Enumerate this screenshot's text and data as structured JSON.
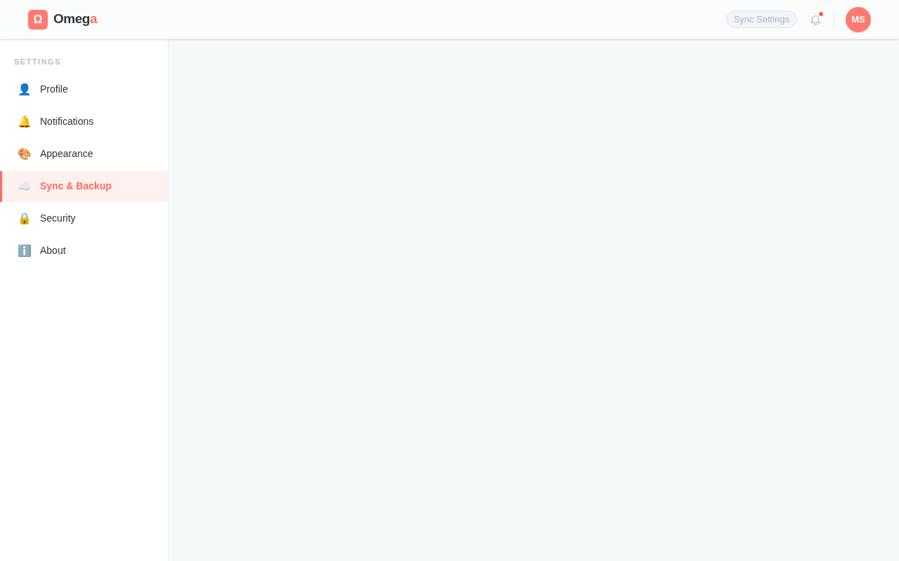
{
  "header": {
    "logo_mark": "Ω",
    "logo_text": "Omeg",
    "logo_accent": "a",
    "sync_button": {
      "label": "Sync Settings",
      "disabled": true
    },
    "notifications": {
      "unread": true
    },
    "avatar": "MS"
  },
  "sidebar": {
    "heading": "SETTINGS",
    "items": [
      {
        "icon": "👤",
        "label": "Profile",
        "selected": false
      },
      {
        "icon": "🔔",
        "label": "Notifications",
        "selected": false
      },
      {
        "icon": "🎨",
        "label": "Appearance",
        "selected": false
      },
      {
        "icon": "☁️",
        "label": "Sync & Backup",
        "selected": true
      },
      {
        "icon": "🔒",
        "label": "Security",
        "selected": false
      },
      {
        "icon": "ℹ️",
        "label": "About",
        "selected": false
      }
    ]
  }
}
